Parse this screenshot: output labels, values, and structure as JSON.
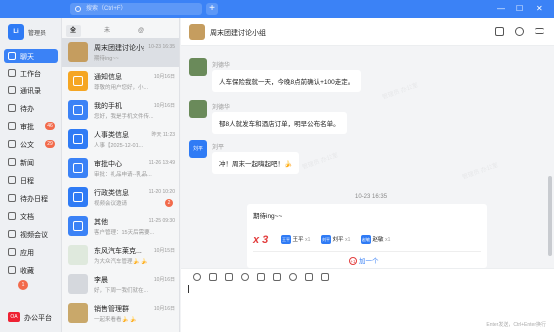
{
  "app": {
    "search_placeholder": "搜索（Ctrl+F）",
    "add_label": "+",
    "window_controls": [
      "—",
      "☐",
      "✕"
    ]
  },
  "sidebar": {
    "user_label": "管理员",
    "avatar_text": "Li",
    "items": [
      {
        "label": "聊天",
        "badge": ""
      },
      {
        "label": "工作台",
        "badge": ""
      },
      {
        "label": "通讯录",
        "badge": ""
      },
      {
        "label": "待办",
        "badge": ""
      },
      {
        "label": "审批",
        "badge": "46"
      },
      {
        "label": "公文",
        "badge": "29"
      },
      {
        "label": "新闻",
        "badge": ""
      },
      {
        "label": "日程",
        "badge": ""
      },
      {
        "label": "待办日程",
        "badge": ""
      },
      {
        "label": "文档",
        "badge": ""
      },
      {
        "label": "视频会议",
        "badge": ""
      },
      {
        "label": "应用",
        "badge": ""
      },
      {
        "label": "收藏",
        "badge": ""
      }
    ],
    "side_badge": "1",
    "platform_icon": "OA",
    "platform_label": "办公平台"
  },
  "conversations": {
    "tabs": [
      "全部 33",
      "未读 33",
      "@我"
    ],
    "items": [
      {
        "title": "周末团建讨论小组",
        "time": "10-23 16:35",
        "preview": "期待ing~~",
        "color": "#c59d5f",
        "unread": ""
      },
      {
        "title": "通知信息",
        "time": "10月16日",
        "preview": "尊敬的用户您好，小...",
        "color": "#f5a623",
        "unread": ""
      },
      {
        "title": "我的手机",
        "time": "10月16日",
        "preview": "您好，我是手机文件传...",
        "color": "#3b82f6",
        "unread": ""
      },
      {
        "title": "人事类信息",
        "time": "昨天 11:23",
        "preview": "人事【2025-12-01...",
        "color": "#2f7bf5",
        "unread": ""
      },
      {
        "title": "审批中心",
        "time": "11-26 13:49",
        "preview": "审批：礼品申请--乳品...",
        "color": "#3b82f6",
        "unread": ""
      },
      {
        "title": "行政类信息",
        "time": "11-20 10:20",
        "preview": "视频会议邀请",
        "color": "#2f7bf5",
        "unread": "2"
      },
      {
        "title": "其他",
        "time": "11-25 09:30",
        "preview": "客户管理：15天后需要...",
        "color": "#3b82f6",
        "unread": ""
      },
      {
        "title": "东风汽车莱克...",
        "time": "10月15日",
        "preview": "为大众汽车管理🍌 🍌",
        "color": "#e8eef7",
        "unread": ""
      },
      {
        "title": "李晨",
        "time": "10月16日",
        "preview": "好，下周一我们就在...",
        "color": "#d5d8dd",
        "unread": ""
      },
      {
        "title": "销售管理群",
        "time": "10月16日",
        "preview": "一起来看看🍌 🍌",
        "color": "#c9a86a",
        "unread": ""
      }
    ]
  },
  "chat": {
    "title": "周末团建讨论小组",
    "messages": [
      {
        "name": "刘德华",
        "text": "人车保险我就一天，今晚8点前确认+100走定。"
      },
      {
        "name": "刘德华",
        "text": "郁8人就发车和酒店订单，明早公布名单。"
      },
      {
        "name": "刘平",
        "text": "冲！周末一起嗨起吧！🍌"
      }
    ],
    "timestamp": "10-23 16:35",
    "card": {
      "text": "期待ing~~",
      "count": "x 3",
      "participants": [
        {
          "badge": "王平",
          "name": "王平",
          "count": "x1"
        },
        {
          "badge": "刘平",
          "name": "刘平",
          "count": "x1"
        },
        {
          "badge": "赵敏",
          "name": "赵敏",
          "count": "x1"
        }
      ],
      "plus_icon": "+1",
      "plus_label": "加一个"
    },
    "compose_hint": "Enter发送，Ctrl+Enter换行",
    "watermark": "管理员 办公室"
  }
}
